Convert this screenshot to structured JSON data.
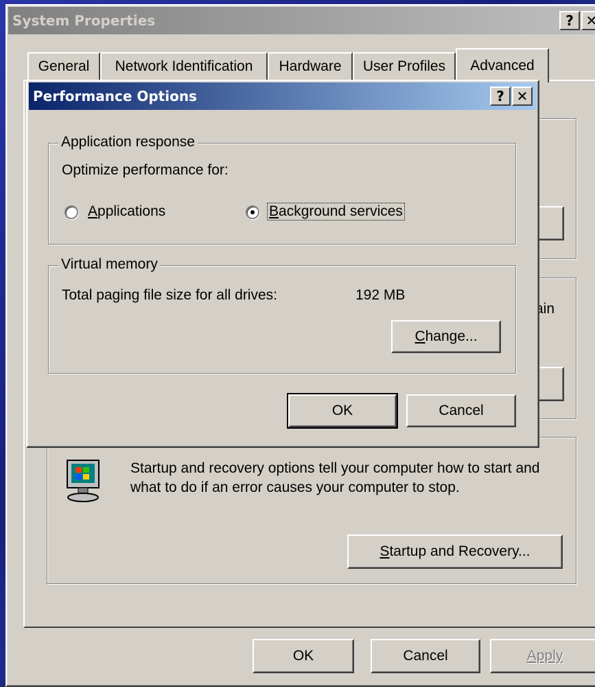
{
  "system_properties": {
    "title": "System Properties",
    "help_btn": "?",
    "close_btn": "✕",
    "tabs": [
      {
        "label": "General"
      },
      {
        "label": "Network Identification"
      },
      {
        "label": "Hardware"
      },
      {
        "label": "User Profiles"
      },
      {
        "label": "Advanced"
      }
    ],
    "partial_text_right": "ain",
    "startup": {
      "description": "Startup and recovery options tell your computer how to start and what to do if an error causes your computer to stop.",
      "button_label_prefix": "",
      "button_label_underline": "S",
      "button_label_rest": "tartup and Recovery..."
    },
    "footer": {
      "ok": "OK",
      "cancel": "Cancel",
      "apply": "Apply"
    }
  },
  "performance_options": {
    "title": "Performance Options",
    "help_btn": "?",
    "close_btn": "✕",
    "app_response": {
      "legend": "Application response",
      "prompt": "Optimize performance for:",
      "options": [
        {
          "underline": "A",
          "rest": "pplications",
          "checked": false
        },
        {
          "underline": "B",
          "rest": "ackground services",
          "checked": true
        }
      ]
    },
    "virtual_memory": {
      "legend": "Virtual memory",
      "paging_label": "Total paging file size for all drives:",
      "paging_value": "192 MB",
      "change_underline": "C",
      "change_rest": "hange..."
    },
    "ok": "OK",
    "cancel": "Cancel"
  },
  "colors": {
    "titlebar_active_start": "#0a246a",
    "titlebar_active_end": "#a6caf0",
    "titlebar_inactive_start": "#808080",
    "titlebar_inactive_end": "#c0c0c0",
    "face": "#d4d0c8"
  }
}
